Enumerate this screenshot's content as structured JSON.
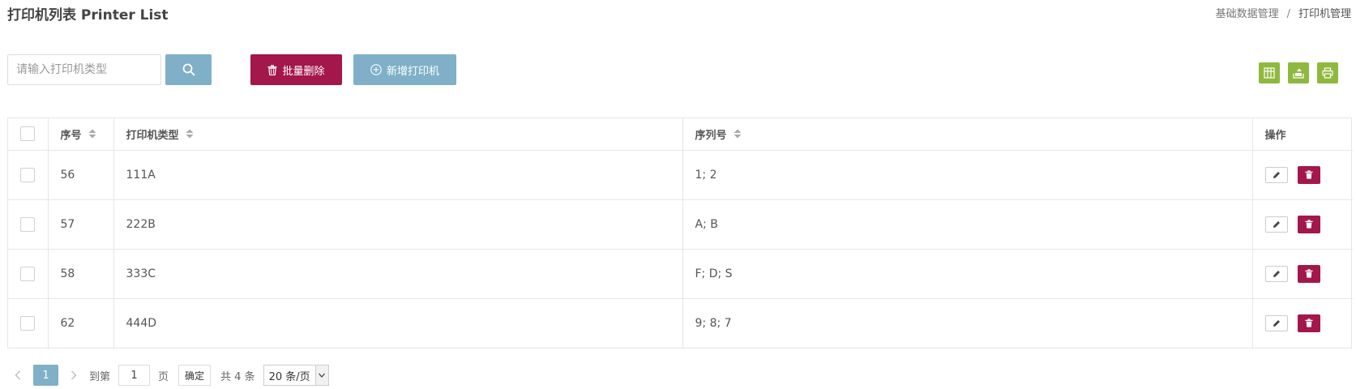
{
  "header": {
    "title": "打印机列表 Printer List",
    "breadcrumb": {
      "parent": "基础数据管理",
      "separator": "/",
      "current": "打印机管理"
    }
  },
  "toolbar": {
    "search_placeholder": "请输入打印机类型",
    "search_value": "",
    "batch_delete_label": "批量删除",
    "add_label": "新增打印机",
    "colors": {
      "danger": "#a3174a",
      "primary": "#7fb0c8",
      "tool": "#8fb83f"
    },
    "tools": [
      "columns-icon",
      "export-icon",
      "print-icon"
    ]
  },
  "table": {
    "columns": [
      "序号",
      "打印机类型",
      "序列号",
      "操作"
    ],
    "rows": [
      {
        "id": "56",
        "type": "111A",
        "serial": "1; 2"
      },
      {
        "id": "57",
        "type": "222B",
        "serial": "A; B"
      },
      {
        "id": "58",
        "type": "333C",
        "serial": "F; D; S"
      },
      {
        "id": "62",
        "type": "444D",
        "serial": "9; 8; 7"
      }
    ]
  },
  "pagination": {
    "current_page": "1",
    "goto_label": "到第",
    "goto_value": "1",
    "page_unit": "页",
    "confirm_label": "确定",
    "total_label": "共 4 条",
    "page_size_label": "20 条/页"
  }
}
